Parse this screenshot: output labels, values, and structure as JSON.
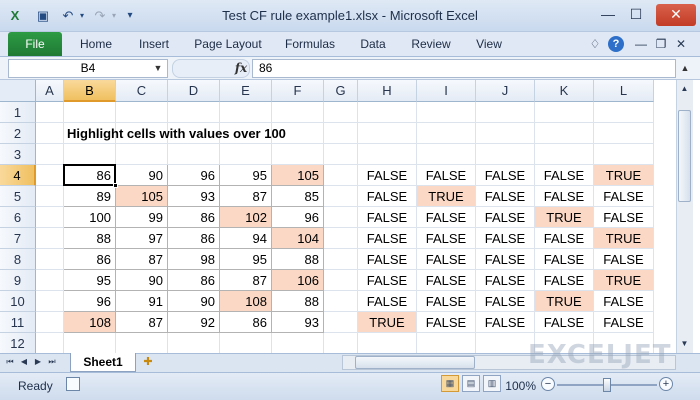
{
  "window": {
    "title": "Test CF rule example1.xlsx  -  Microsoft Excel",
    "min_glyph": "—",
    "max_glyph": "☐",
    "close_glyph": "✕"
  },
  "ribbon": {
    "file_tab": "File",
    "tabs": [
      "Home",
      "Insert",
      "Page Layout",
      "Formulas",
      "Data",
      "Review",
      "View"
    ],
    "help_glyph": "?"
  },
  "formula_bar": {
    "name_box": "B4",
    "fx": "fx",
    "value": "86"
  },
  "grid": {
    "columns": [
      "A",
      "B",
      "C",
      "D",
      "E",
      "F",
      "G",
      "H",
      "I",
      "J",
      "K",
      "L"
    ],
    "rows": [
      "1",
      "2",
      "3",
      "4",
      "5",
      "6",
      "7",
      "8",
      "9",
      "10",
      "11",
      "12"
    ],
    "selected_cell": "B4",
    "heading_text": "Highlight cells with values over 100",
    "values": [
      [
        86,
        90,
        96,
        95,
        105
      ],
      [
        89,
        105,
        93,
        87,
        85
      ],
      [
        100,
        99,
        86,
        102,
        96
      ],
      [
        88,
        97,
        86,
        94,
        104
      ],
      [
        86,
        87,
        98,
        95,
        88
      ],
      [
        95,
        90,
        86,
        87,
        106
      ],
      [
        96,
        91,
        90,
        108,
        88
      ],
      [
        108,
        87,
        92,
        86,
        93
      ]
    ],
    "tests": [
      [
        "FALSE",
        "FALSE",
        "FALSE",
        "FALSE",
        "TRUE"
      ],
      [
        "FALSE",
        "TRUE",
        "FALSE",
        "FALSE",
        "FALSE"
      ],
      [
        "FALSE",
        "FALSE",
        "FALSE",
        "TRUE",
        "FALSE"
      ],
      [
        "FALSE",
        "FALSE",
        "FALSE",
        "FALSE",
        "TRUE"
      ],
      [
        "FALSE",
        "FALSE",
        "FALSE",
        "FALSE",
        "FALSE"
      ],
      [
        "FALSE",
        "FALSE",
        "FALSE",
        "FALSE",
        "TRUE"
      ],
      [
        "FALSE",
        "FALSE",
        "FALSE",
        "TRUE",
        "FALSE"
      ],
      [
        "TRUE",
        "FALSE",
        "FALSE",
        "FALSE",
        "FALSE"
      ]
    ],
    "highlight_color": "#fbd8c5"
  },
  "sheets": {
    "active": "Sheet1"
  },
  "status": {
    "ready": "Ready",
    "zoom": "100%"
  },
  "watermark": "EXCELJET"
}
